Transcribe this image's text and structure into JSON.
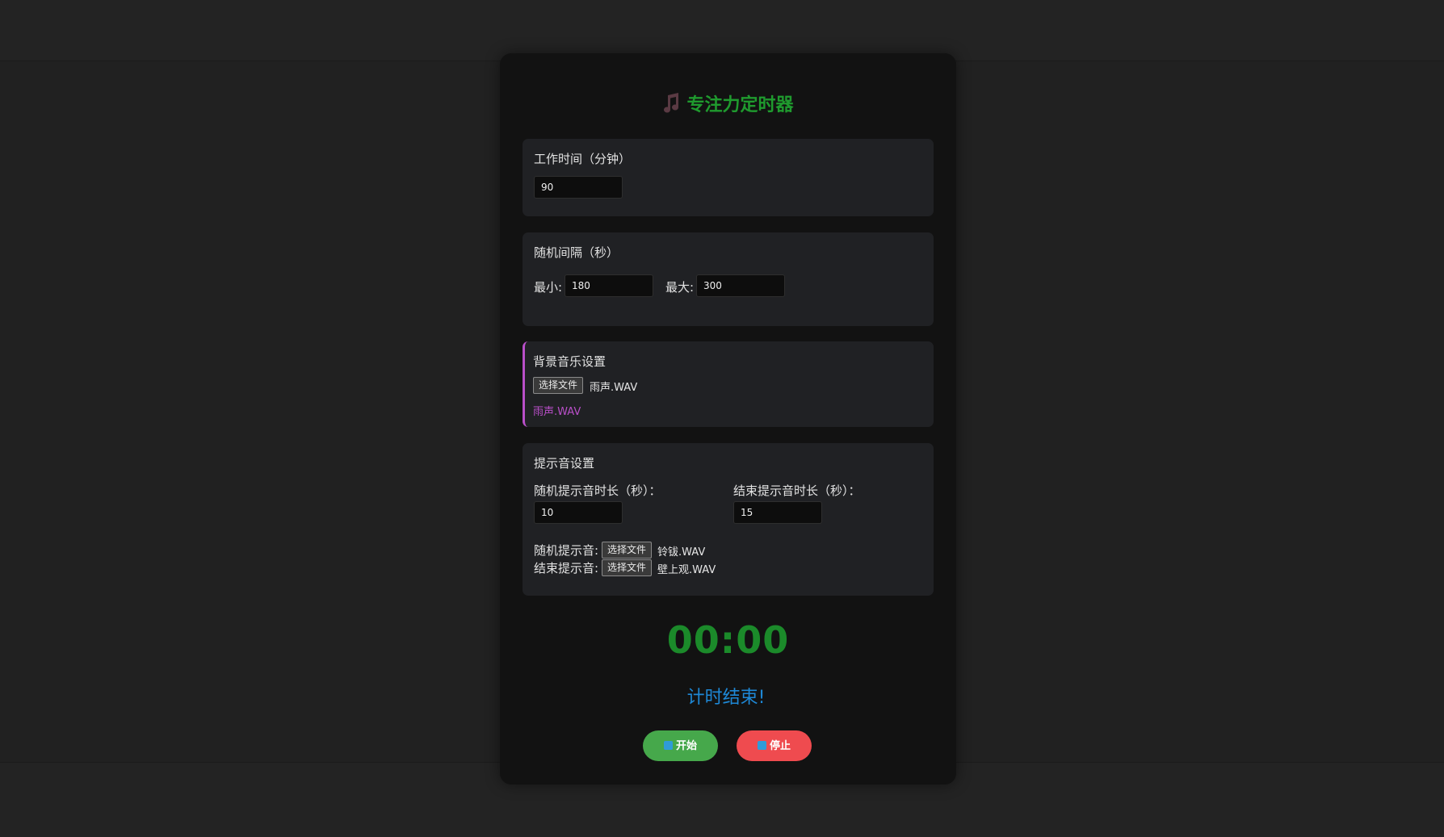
{
  "app": {
    "title": "专注力定时器",
    "title_icon": "music-note-icon"
  },
  "work": {
    "label": "工作时间（分钟）",
    "value": "90"
  },
  "interval": {
    "label": "随机间隔（秒）",
    "min_label": "最小:",
    "min_value": "180",
    "max_label": "最大:",
    "max_value": "300"
  },
  "bgm": {
    "label": "背景音乐设置",
    "file_button": "选择文件",
    "file_name": "雨声.WAV",
    "current": "雨声.WAV"
  },
  "alerts": {
    "label": "提示音设置",
    "random_duration_label": "随机提示音时长（秒）：",
    "random_duration_value": "10",
    "end_duration_label": "结束提示音时长（秒）：",
    "end_duration_value": "15",
    "random_sound_label": "随机提示音:",
    "random_sound_button": "选择文件",
    "random_sound_file": "铃钹.WAV",
    "end_sound_label": "结束提示音:",
    "end_sound_button": "选择文件",
    "end_sound_file": "壁上观.WAV"
  },
  "timer": {
    "display": "00:00",
    "status": "计时结束!"
  },
  "controls": {
    "start_label": "开始",
    "stop_label": "停止",
    "start_icon": "play-icon",
    "stop_icon": "stop-icon"
  },
  "colors": {
    "title_green": "#1f9a2e",
    "timer_green": "#1b8a2a",
    "status_blue": "#1e88d6",
    "accent_purple": "#b94fc9",
    "start_green": "#46a84b",
    "stop_red": "#ef4b4f"
  }
}
